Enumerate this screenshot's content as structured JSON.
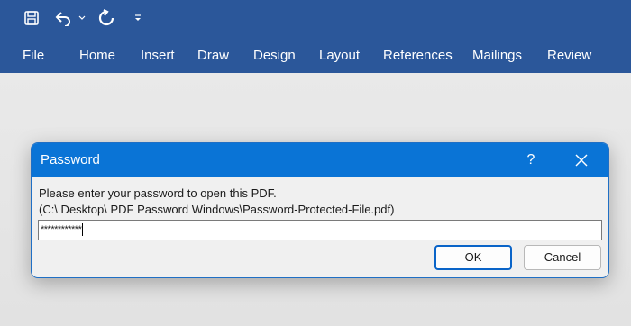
{
  "ribbon": {
    "quick_access": {
      "save": "save-icon",
      "undo": "undo-icon",
      "undo_dropdown": "chevron-down-icon",
      "redo": "redo-icon",
      "customize": "customize-icon"
    },
    "tabs": [
      "File",
      "Home",
      "Insert",
      "Draw",
      "Design",
      "Layout",
      "References",
      "Mailings",
      "Review"
    ],
    "color": "#2b579a"
  },
  "dialog": {
    "title": "Password",
    "help_label": "?",
    "message": "Please enter your password to open this PDF.",
    "path": "(C:\\ Desktop\\ PDF Password Windows\\Password-Protected-File.pdf)",
    "password_value": "************",
    "ok_label": "OK",
    "cancel_label": "Cancel",
    "title_color": "#0a74d6"
  }
}
